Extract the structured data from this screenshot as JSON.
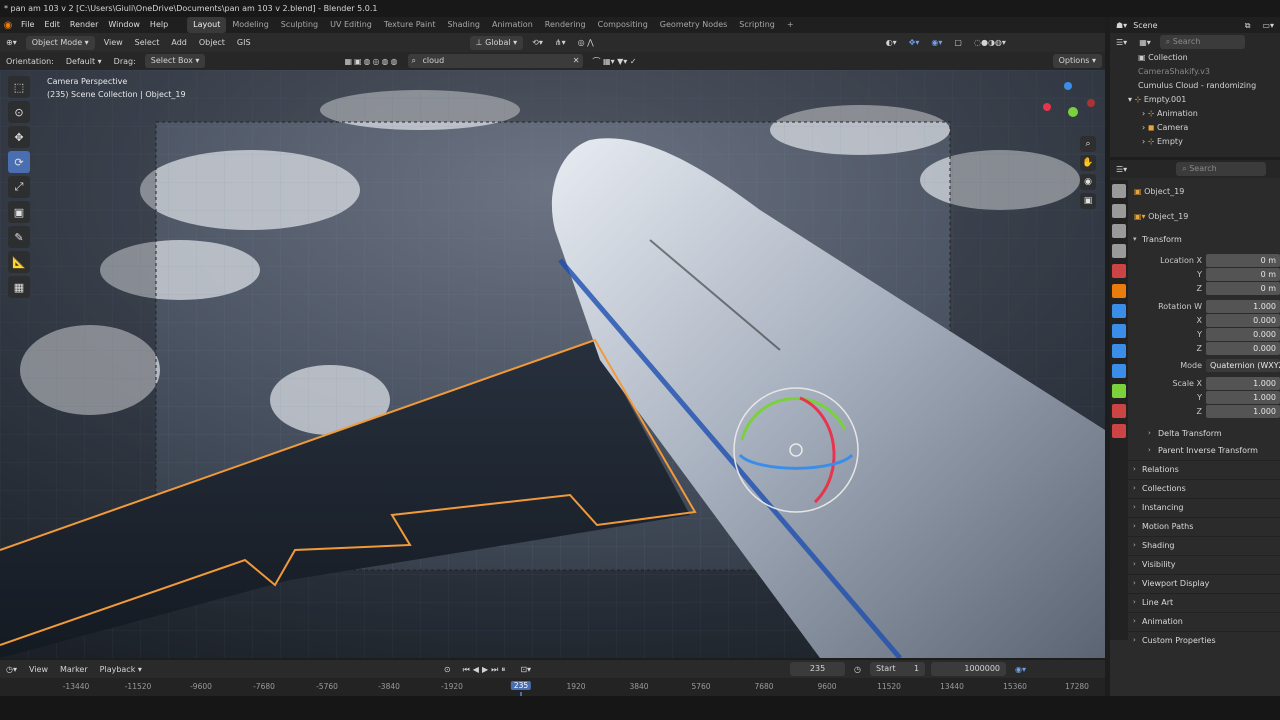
{
  "title_bar": {
    "text": "* pan am 103 v 2 [C:\\Users\\Giuli\\OneDrive\\Documents\\pan am 103 v 2.blend] - Blender 5.0.1"
  },
  "menu": {
    "items": [
      "File",
      "Edit",
      "Render",
      "Window",
      "Help"
    ],
    "workspaces": [
      "Layout",
      "Modeling",
      "Sculpting",
      "UV Editing",
      "Texture Paint",
      "Shading",
      "Animation",
      "Rendering",
      "Compositing",
      "Geometry Nodes",
      "Scripting"
    ],
    "add_tab": "+"
  },
  "viewport_header": {
    "mode": "Object Mode",
    "menus": [
      "View",
      "Select",
      "Add",
      "Object",
      "GIS"
    ],
    "transform_orientation": "Global"
  },
  "tool_header": {
    "orientation_label": "Orientation:",
    "orientation_value": "Default",
    "drag_label": "Drag:",
    "drag_value": "Select Box",
    "search_value": "cloud",
    "options": "Options"
  },
  "viewport": {
    "view_name": "Camera Perspective",
    "collection_info": "(235) Scene Collection | Object_19"
  },
  "timeline": {
    "menus": [
      "View",
      "Marker",
      "Playback"
    ],
    "current_frame": "235",
    "start_label": "Start",
    "start_value": "1",
    "end_value": "1000000",
    "ruler_ticks": [
      "-13440",
      "-11520",
      "-9600",
      "-7680",
      "-5760",
      "-3840",
      "-1920",
      "235",
      "1920",
      "3840",
      "5760",
      "7680",
      "9600",
      "11520",
      "13440",
      "15360",
      "17280"
    ]
  },
  "outliner": {
    "scene": "Scene",
    "search_placeholder": "Search",
    "rows": [
      "Collection",
      "CameraShakify.v3",
      "Cumulus Cloud - randomizing",
      "Empty.001",
      "Animation",
      "Camera",
      "Empty"
    ]
  },
  "properties": {
    "search_placeholder": "Search",
    "object_name": "Object_19",
    "object_field": "Object_19",
    "transform_panel": "Transform",
    "location": {
      "label": "Location X",
      "x": "0 m",
      "y": "0 m",
      "z": "0 m"
    },
    "rotation": {
      "label": "Rotation W",
      "w": "1.000",
      "x": "0.000",
      "y": "0.000",
      "z": "0.000"
    },
    "axis_labels": {
      "x": "X",
      "y": "Y",
      "z": "Z"
    },
    "mode_label": "Mode",
    "mode_value": "Quaternion (WXYZ)",
    "scale": {
      "label": "Scale X",
      "x": "1.000",
      "y": "1.000",
      "z": "1.000"
    },
    "subpanels": [
      "Delta Transform",
      "Parent Inverse Transform"
    ],
    "panels": [
      "Relations",
      "Collections",
      "Instancing",
      "Motion Paths",
      "Shading",
      "Visibility",
      "Viewport Display",
      "Line Art",
      "Animation",
      "Custom Properties"
    ]
  },
  "colors": {
    "accent_blue": "#4a6fb0",
    "selection_orange": "#f29a3a",
    "gizmo_red": "#e8344e",
    "gizmo_green": "#7ad13b",
    "gizmo_blue": "#3b8ee8"
  }
}
